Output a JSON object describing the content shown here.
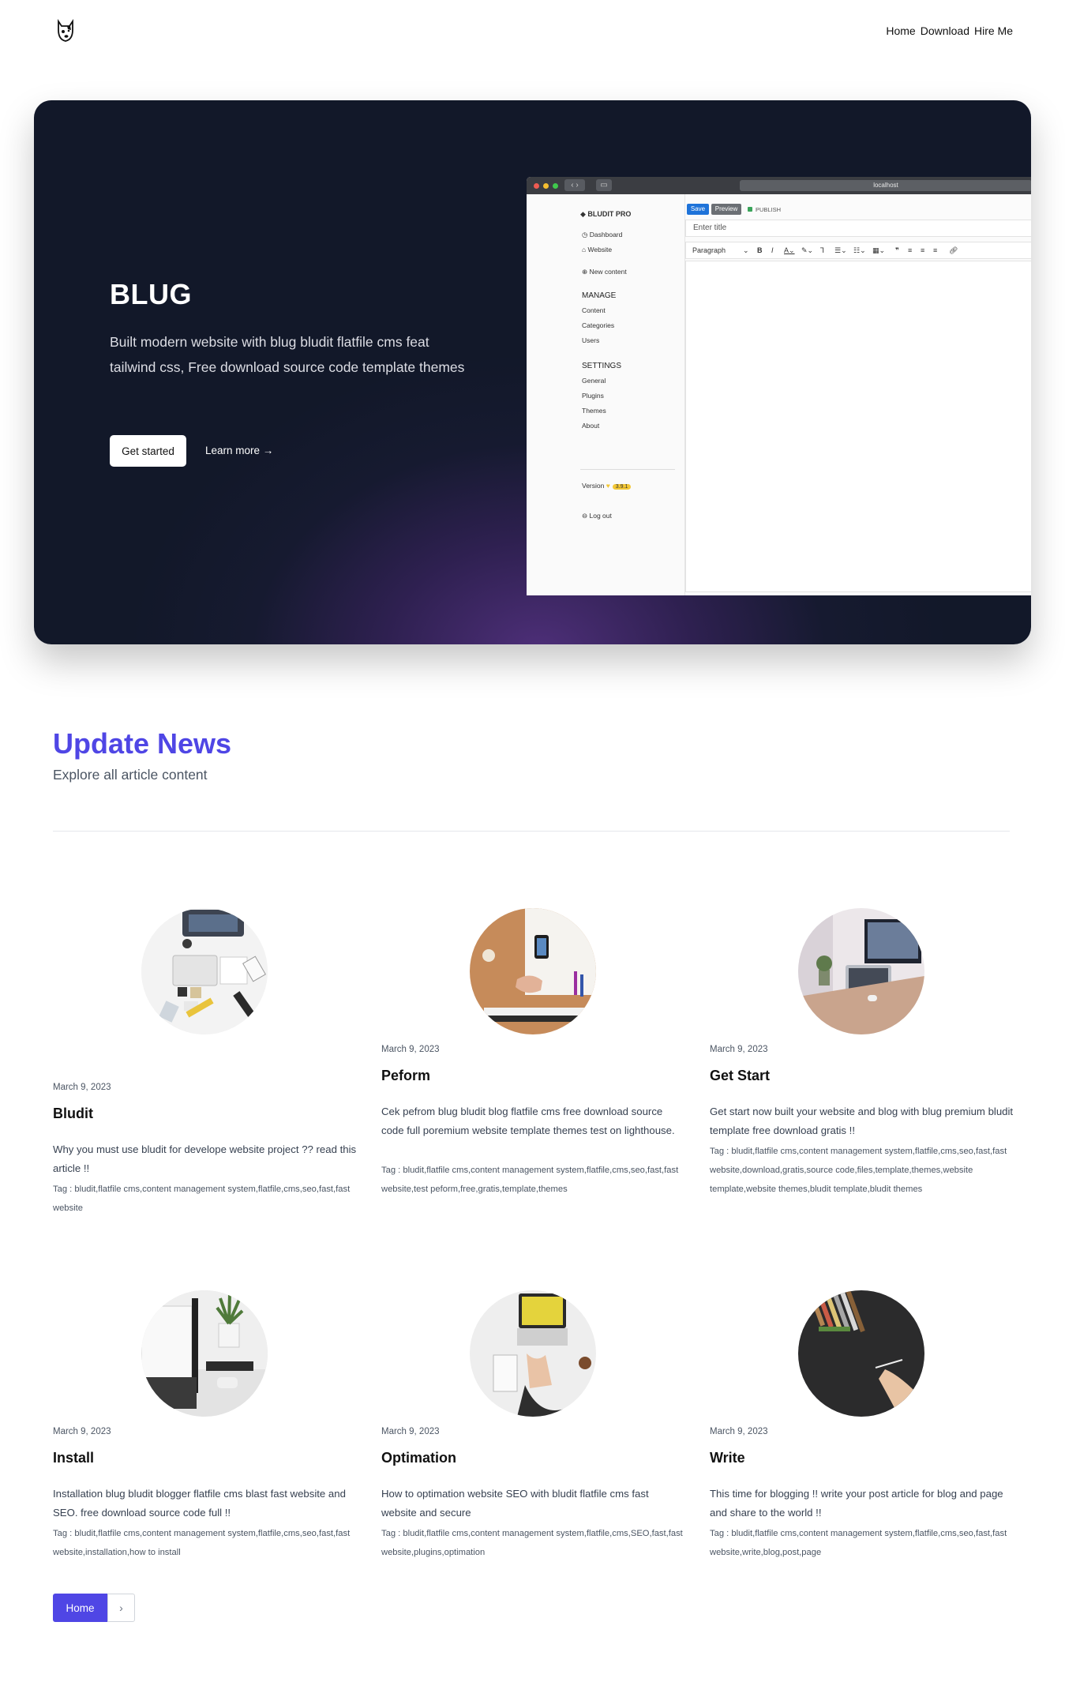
{
  "nav": {
    "logo_icon": "dog-logo-icon",
    "links": [
      "Home",
      "Download",
      "Hire Me"
    ]
  },
  "hero": {
    "title": "BLUG",
    "text": "Built modern website with blug bludit flatfile cms feat tailwind css, Free download source code template themes",
    "primary_button": "Get started",
    "secondary_button": "Learn more →",
    "mockup": {
      "url": "localhost",
      "brand": "BLUDIT PRO",
      "dashboard": "Dashboard",
      "website": "Website",
      "new_content": "New content",
      "manage_heading": "MANAGE",
      "manage_items": [
        "Content",
        "Categories",
        "Users"
      ],
      "settings_heading": "SETTINGS",
      "settings_items": [
        "General",
        "Plugins",
        "Themes",
        "About"
      ],
      "version_label": "Version",
      "version_value": "3.9.1",
      "logout": "Log out",
      "save": "Save",
      "preview": "Preview",
      "publish": "PUBLISH",
      "title_placeholder": "Enter title",
      "paragraph": "Paragraph"
    }
  },
  "section": {
    "title": "Update News",
    "subtitle": "Explore all article content"
  },
  "articles": [
    {
      "date": "March 9, 2023",
      "title": "Bludit",
      "desc": "Why you must use bludit for develope website project ?? read this article !!",
      "tags": "Tag : bludit,flatfile cms,content management system,flatfile,cms,seo,fast,fast website"
    },
    {
      "date": "March 9, 2023",
      "title": "Peform",
      "desc": "Cek pefrom blug bludit blog flatfile cms free download source code full poremium website template themes test on lighthouse.",
      "tags": "Tag : bludit,flatfile cms,content management system,flatfile,cms,seo,fast,fast website,test peform,free,gratis,template,themes"
    },
    {
      "date": "March 9, 2023",
      "title": "Get Start",
      "desc": "Get start now built your website and blog with blug premium bludit template free download gratis !!",
      "tags": "Tag : bludit,flatfile cms,content management system,flatfile,cms,seo,fast,fast website,download,gratis,source code,files,template,themes,website template,website themes,bludit template,bludit themes"
    },
    {
      "date": "March 9, 2023",
      "title": "Install",
      "desc": "Installation blug bludit blogger flatfile cms blast fast website and SEO. free download source code full !!",
      "tags": "Tag : bludit,flatfile cms,content management system,flatfile,cms,seo,fast,fast website,installation,how to install"
    },
    {
      "date": "March 9, 2023",
      "title": "Optimation",
      "desc": "How to optimation website SEO with bludit flatfile cms fast website and secure",
      "tags": "Tag : bludit,flatfile cms,content management system,flatfile,cms,SEO,fast,fast website,plugins,optimation"
    },
    {
      "date": "March 9, 2023",
      "title": "Write",
      "desc": "This time for blogging !! write your post article for blog and page and share to the world !!",
      "tags": "Tag : bludit,flatfile cms,content management system,flatfile,cms,seo,fast,fast website,write,blog,post,page"
    }
  ],
  "pagination": {
    "home": "Home",
    "next_icon": "chevron-right-icon"
  },
  "colors": {
    "accent": "#4f46e5",
    "hero_bg": "#121829"
  }
}
